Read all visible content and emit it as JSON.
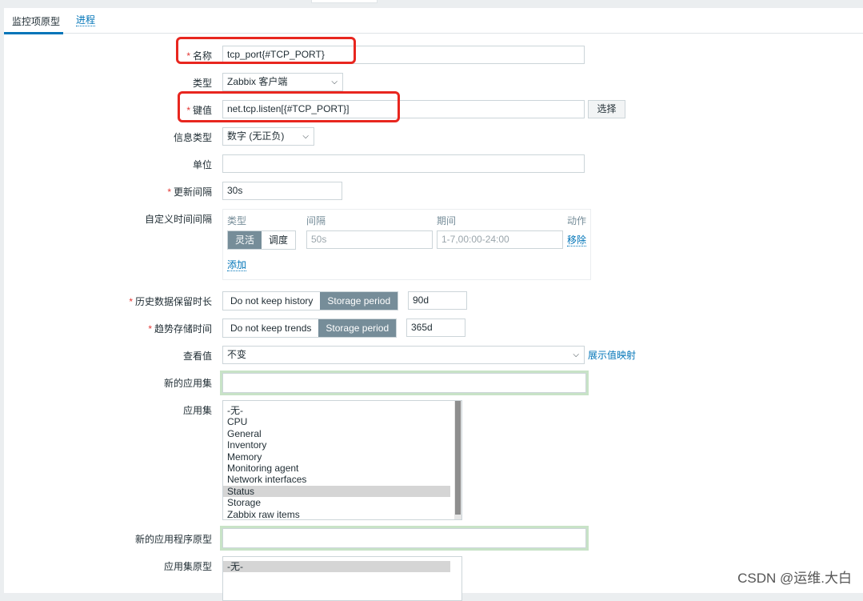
{
  "tabs": [
    {
      "label": "监控项原型"
    },
    {
      "label": "进程"
    }
  ],
  "form": {
    "name": {
      "label": "名称",
      "value": "tcp_port{#TCP_PORT}"
    },
    "type": {
      "label": "类型",
      "value": "Zabbix 客户端"
    },
    "key": {
      "label": "键值",
      "value": "net.tcp.listen[{#TCP_PORT}]",
      "button": "选择"
    },
    "info_type": {
      "label": "信息类型",
      "value": "数字 (无正负)"
    },
    "units": {
      "label": "单位",
      "value": ""
    },
    "update_interval": {
      "label": "更新间隔",
      "value": "30s"
    },
    "custom_intervals": {
      "label": "自定义时间间隔",
      "col_type": "类型",
      "col_interval": "间隔",
      "col_period": "期间",
      "col_action": "动作",
      "opt_flexible": "灵活",
      "opt_scheduling": "调度",
      "interval_placeholder": "50s",
      "period_placeholder": "1-7,00:00-24:00",
      "remove": "移除",
      "add": "添加"
    },
    "history": {
      "label": "历史数据保留时长",
      "opt_no_keep": "Do not keep history",
      "opt_storage": "Storage period",
      "value": "90d"
    },
    "trends": {
      "label": "趋势存储时间",
      "opt_no_keep": "Do not keep trends",
      "opt_storage": "Storage period",
      "value": "365d"
    },
    "show_value": {
      "label": "查看值",
      "value": "不变",
      "link": "展示值映射"
    },
    "new_application": {
      "label": "新的应用集",
      "value": ""
    },
    "applications": {
      "label": "应用集",
      "options": [
        "-无-",
        "CPU",
        "General",
        "Inventory",
        "Memory",
        "Monitoring agent",
        "Network interfaces",
        "Status",
        "Storage",
        "Zabbix raw items"
      ],
      "selected": "Status"
    },
    "new_app_prototype": {
      "label": "新的应用程序原型",
      "value": ""
    },
    "app_prototypes": {
      "label": "应用集原型",
      "options": [
        "-无-"
      ],
      "selected": "-无-"
    }
  },
  "watermark": "CSDN @运维.大白",
  "colors": {
    "accent": "#0275b8",
    "required": "#e33734",
    "annotation_red": "#e8261f",
    "toggle_on": "#768d99"
  }
}
